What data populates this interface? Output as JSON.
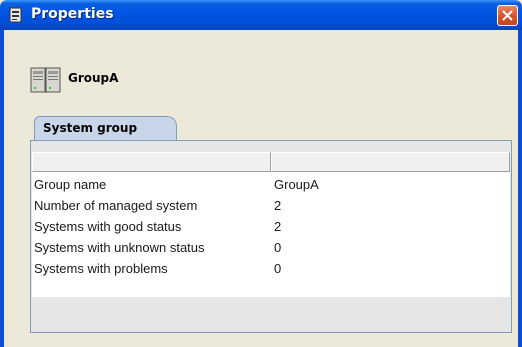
{
  "window": {
    "title": "Properties",
    "title_icon": "document-properties-icon",
    "close_icon": "close-icon"
  },
  "header": {
    "icon": "system-group-icon",
    "name": "GroupA"
  },
  "tabs": [
    {
      "label": "System group",
      "selected": true
    }
  ],
  "table": {
    "columns": [
      "",
      ""
    ],
    "rows": [
      {
        "label": "Group name",
        "value": "GroupA"
      },
      {
        "label": "Number of managed system",
        "value": "2"
      },
      {
        "label": "Systems with good status",
        "value": "2"
      },
      {
        "label": "Systems with unknown status",
        "value": "0"
      },
      {
        "label": "Systems with problems",
        "value": "0"
      }
    ]
  },
  "colors": {
    "titlebar": "#0054e3",
    "close_button": "#d6532a",
    "window_bg": "#ece9d8",
    "tab_bg": "#c9d6ea"
  }
}
